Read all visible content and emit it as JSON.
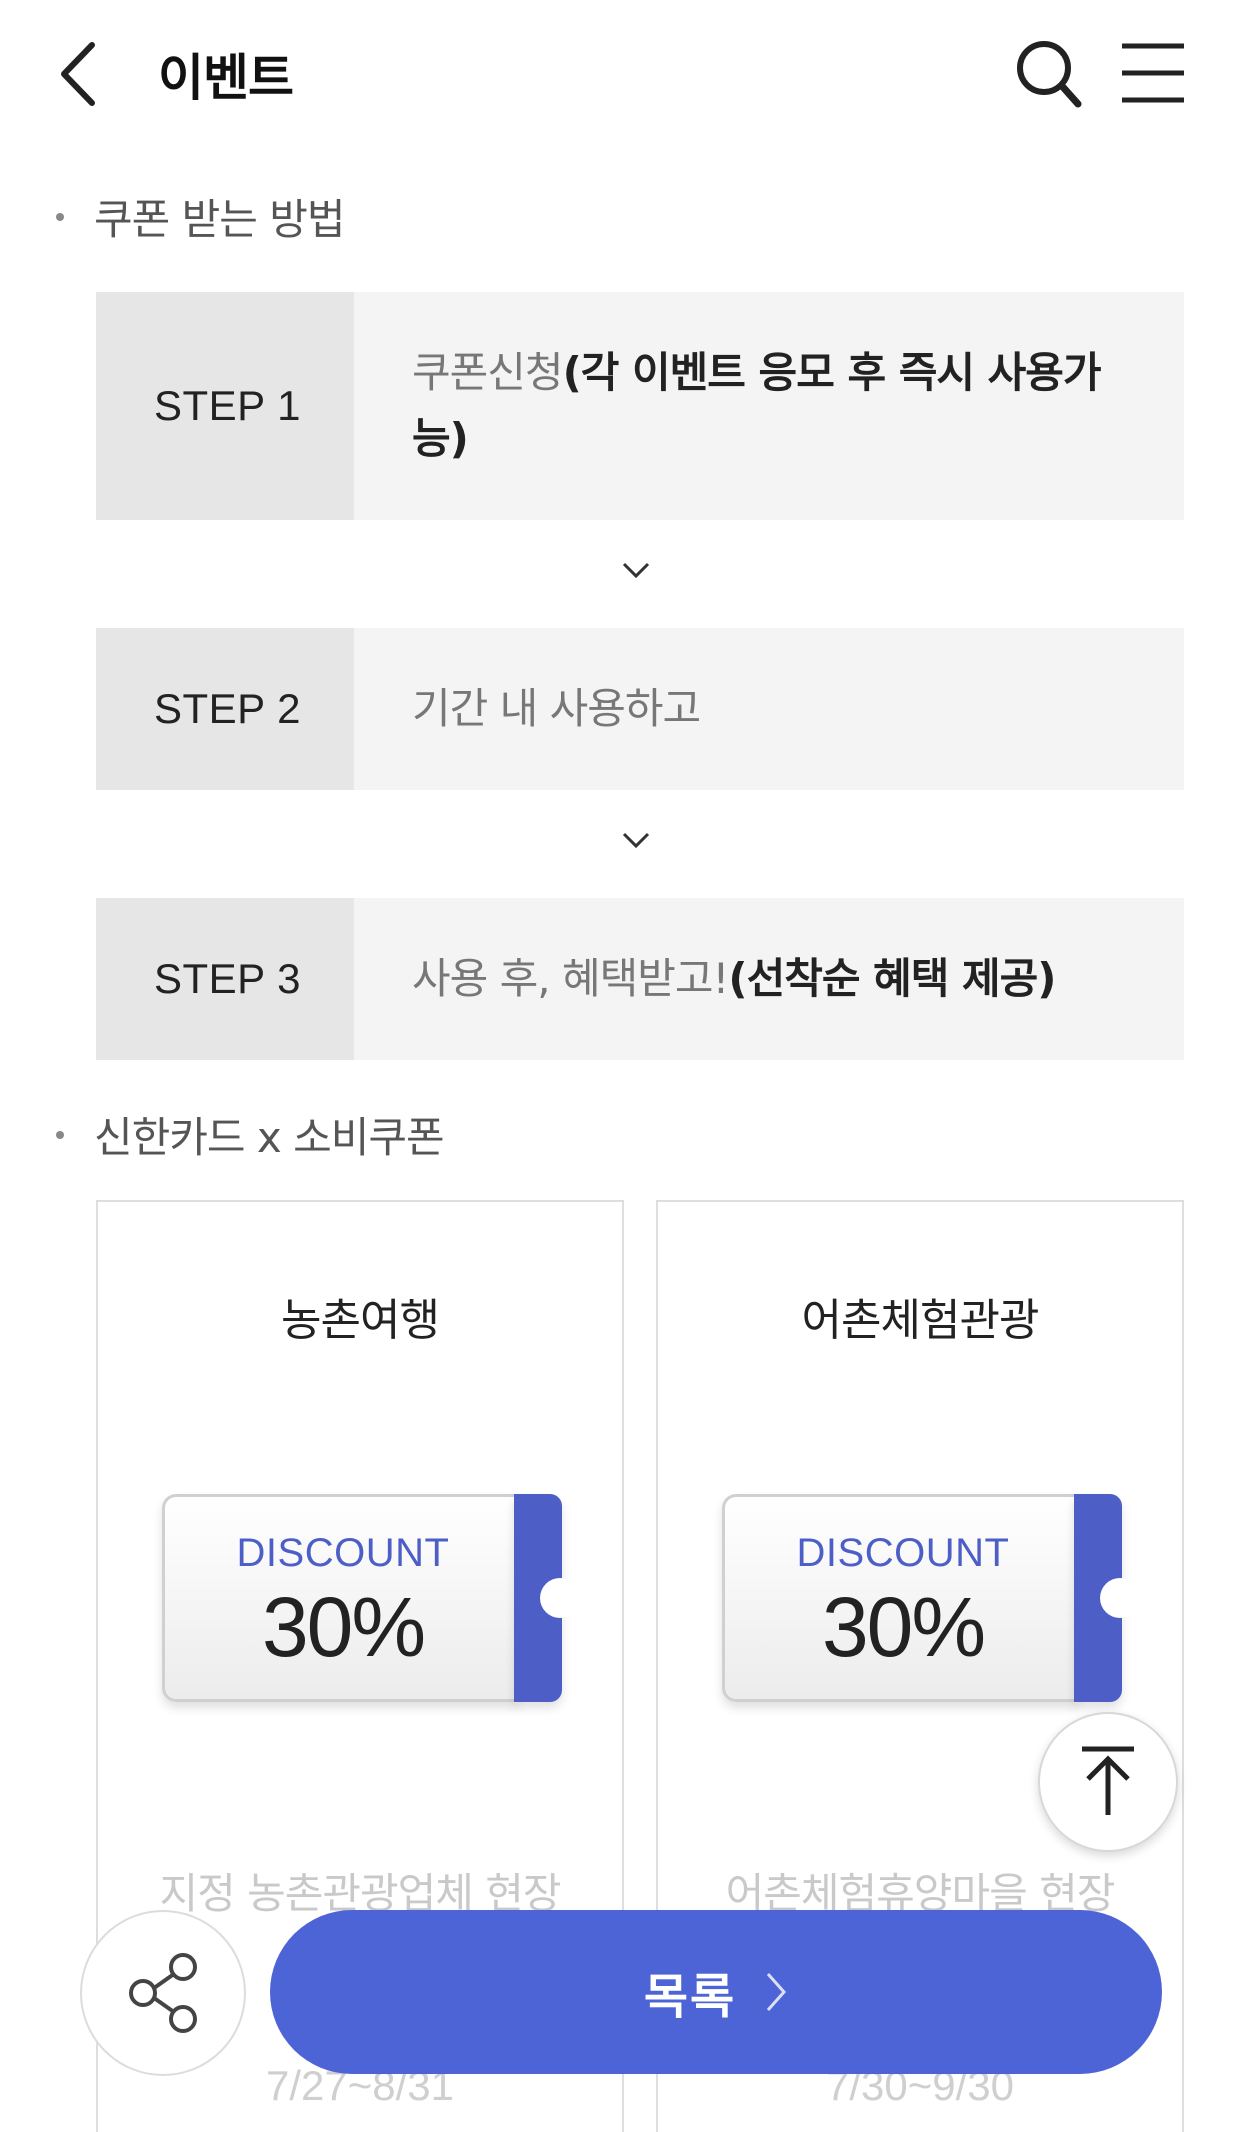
{
  "header": {
    "title": "이벤트"
  },
  "section1": {
    "label": "쿠폰 받는 방법"
  },
  "steps": [
    {
      "label": "STEP 1",
      "text": "쿠폰신청",
      "strong": "(각 이벤트 응모 후 즉시 사용가능)"
    },
    {
      "label": "STEP 2",
      "text": "기간 내 사용하고",
      "strong": ""
    },
    {
      "label": "STEP 3",
      "text": "사용 후, 혜택받고!",
      "strong": "(선착순 혜택 제공)"
    }
  ],
  "section2": {
    "label": "신한카드 x 소비쿠폰"
  },
  "cards": [
    {
      "title": "농촌여행",
      "discount_label": "DISCOUNT",
      "discount_value": "30%",
      "desc": "지정 농촌관광업체 현장",
      "date": "7/27~8/31"
    },
    {
      "title": "어촌체험관광",
      "discount_label": "DISCOUNT",
      "discount_value": "30%",
      "desc": "어촌체험휴양마을 현장",
      "date": "7/30~9/30"
    }
  ],
  "buttons": {
    "list_label": "목록"
  },
  "icons": {
    "back": "chevron-left-icon",
    "search": "search-icon",
    "menu": "hamburger-menu-icon",
    "share": "share-icon",
    "top": "arrow-up-to-top-icon",
    "step_arrow": "chevron-down-icon"
  },
  "colors": {
    "accent": "#4d64d6",
    "ticket_stub": "#4d5fc7",
    "step_label_bg": "#e6e6e6",
    "step_bg": "#f4f4f4"
  }
}
